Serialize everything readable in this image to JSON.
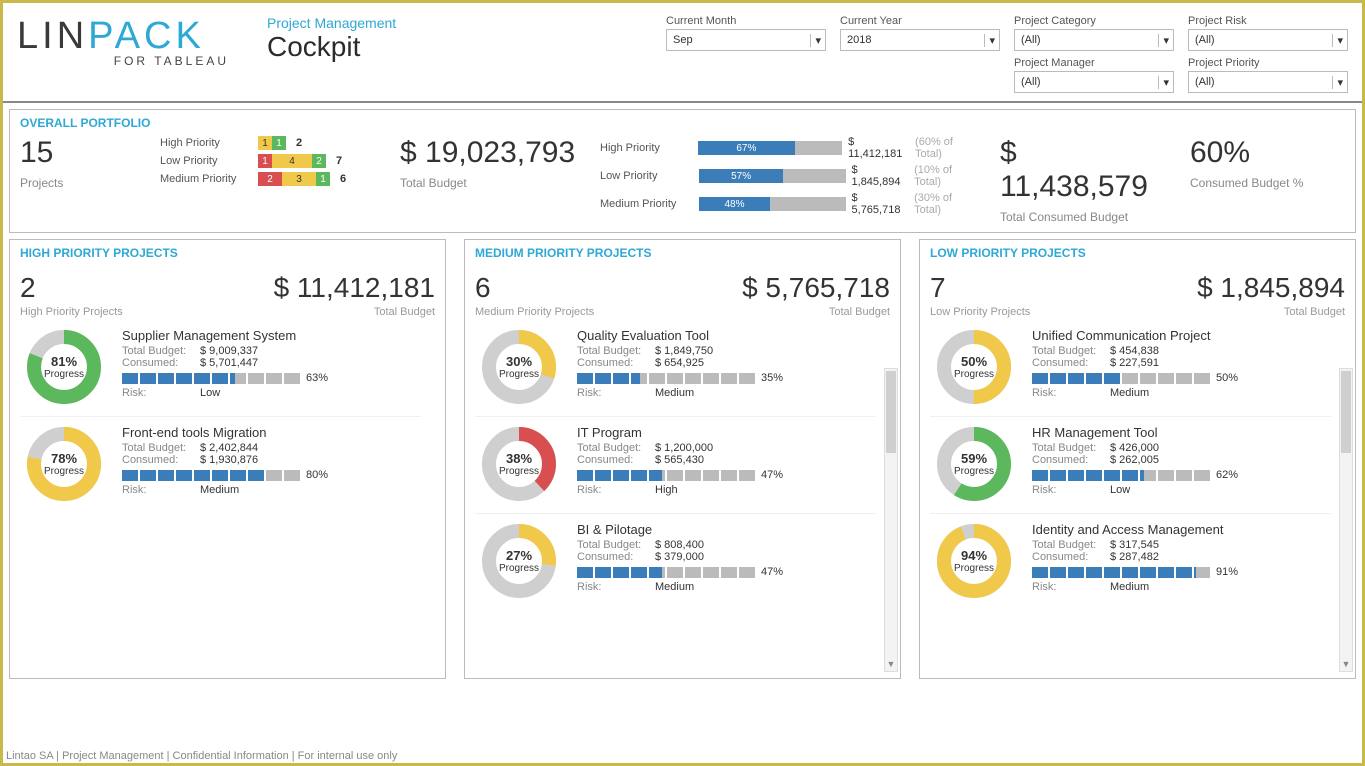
{
  "logo": {
    "part1": "LIN",
    "part2": "PACK",
    "sub": "FOR TABLEAU"
  },
  "title": {
    "section": "Project Management",
    "main": "Cockpit"
  },
  "filters": {
    "items": [
      {
        "label": "Current Month",
        "value": "Sep"
      },
      {
        "label": "Current Year",
        "value": "2018"
      },
      {
        "label": "Project Category",
        "value": "(All)"
      },
      {
        "label": "Project Risk",
        "value": "(All)"
      },
      {
        "label": "",
        "value": ""
      },
      {
        "label": "",
        "value": ""
      },
      {
        "label": "Project Manager",
        "value": "(All)"
      },
      {
        "label": "Project Priority",
        "value": "(All)"
      }
    ]
  },
  "overall": {
    "title": "OVERALL PORTFOLIO",
    "projects": {
      "value": "15",
      "label": "Projects"
    },
    "priority_counts": [
      {
        "name": "High Priority",
        "segments": [
          {
            "w": 14,
            "c": "c-yellow",
            "t": "1"
          },
          {
            "w": 14,
            "c": "c-green",
            "t": "1"
          }
        ],
        "count": "2"
      },
      {
        "name": "Low Priority",
        "segments": [
          {
            "w": 14,
            "c": "c-red",
            "t": "1"
          },
          {
            "w": 40,
            "c": "c-yellow",
            "t": "4"
          },
          {
            "w": 14,
            "c": "c-green",
            "t": "2"
          }
        ],
        "count": "7"
      },
      {
        "name": "Medium Priority",
        "segments": [
          {
            "w": 24,
            "c": "c-red",
            "t": "2"
          },
          {
            "w": 34,
            "c": "c-yellow",
            "t": "3"
          },
          {
            "w": 14,
            "c": "c-green",
            "t": "1"
          }
        ],
        "count": "6"
      }
    ],
    "total_budget": {
      "value": "$ 19,023,793",
      "label": "Total Budget"
    },
    "consumed_bars": [
      {
        "name": "High Priority",
        "pct": 67,
        "amount": "$ 11,412,181",
        "share": "(60% of Total)"
      },
      {
        "name": "Low Priority",
        "pct": 57,
        "amount": "$ 1,845,894",
        "share": "(10% of Total)"
      },
      {
        "name": "Medium Priority",
        "pct": 48,
        "amount": "$ 5,765,718",
        "share": "(30% of Total)"
      }
    ],
    "total_consumed": {
      "value": "$ 11,438,579",
      "label": "Total Consumed Budget"
    },
    "consumed_pct": {
      "value": "60%",
      "label": "Consumed Budget %"
    }
  },
  "columns": [
    {
      "title": "HIGH PRIORITY PROJECTS",
      "count": "2",
      "count_label": "High Priority Projects",
      "budget": "$ 11,412,181",
      "budget_label": "Total Budget",
      "scroll": false,
      "projects": [
        {
          "name": "Supplier Management System",
          "progress": 81,
          "color": "#5cb85c",
          "total": "$ 9,009,337",
          "consumed": "$ 5,701,447",
          "bar": 63,
          "risk": "Low"
        },
        {
          "name": "Front-end tools Migration",
          "progress": 78,
          "color": "#f0c94a",
          "total": "$ 2,402,844",
          "consumed": "$ 1,930,876",
          "bar": 80,
          "risk": "Medium"
        }
      ]
    },
    {
      "title": "MEDIUM PRIORITY PROJECTS",
      "count": "6",
      "count_label": "Medium Priority Projects",
      "budget": "$ 5,765,718",
      "budget_label": "Total Budget",
      "scroll": true,
      "projects": [
        {
          "name": "Quality Evaluation Tool",
          "progress": 30,
          "color": "#f0c94a",
          "total": "$ 1,849,750",
          "consumed": "$ 654,925",
          "bar": 35,
          "risk": "Medium"
        },
        {
          "name": "IT Program",
          "progress": 38,
          "color": "#d94f4f",
          "total": "$ 1,200,000",
          "consumed": "$ 565,430",
          "bar": 47,
          "risk": "High"
        },
        {
          "name": "BI & Pilotage",
          "progress": 27,
          "color": "#f0c94a",
          "total": "$ 808,400",
          "consumed": "$ 379,000",
          "bar": 47,
          "risk": "Medium"
        }
      ]
    },
    {
      "title": "LOW PRIORITY PROJECTS",
      "count": "7",
      "count_label": "Low Priority Projects",
      "budget": "$ 1,845,894",
      "budget_label": "Total Budget",
      "scroll": true,
      "projects": [
        {
          "name": "Unified Communication Project",
          "progress": 50,
          "color": "#f0c94a",
          "total": "$ 454,838",
          "consumed": "$ 227,591",
          "bar": 50,
          "risk": "Medium"
        },
        {
          "name": "HR Management Tool",
          "progress": 59,
          "color": "#5cb85c",
          "total": "$ 426,000",
          "consumed": "$ 262,005",
          "bar": 62,
          "risk": "Low"
        },
        {
          "name": "Identity and Access Management",
          "progress": 94,
          "color": "#f0c94a",
          "total": "$ 317,545",
          "consumed": "$ 287,482",
          "bar": 91,
          "risk": "Medium"
        }
      ]
    }
  ],
  "labels": {
    "progress": "Progress",
    "total_budget": "Total Budget:",
    "consumed": "Consumed:",
    "risk": "Risk:"
  },
  "footer": "Lintao SA | Project Management  | Confidential Information | For internal use only",
  "chart_data": {
    "portfolio_counts": {
      "type": "bar",
      "title": "Project count by priority & risk (stacked)",
      "categories": [
        "High Priority",
        "Low Priority",
        "Medium Priority"
      ],
      "series": [
        {
          "name": "Red",
          "values": [
            0,
            1,
            2
          ]
        },
        {
          "name": "Yellow",
          "values": [
            1,
            4,
            3
          ]
        },
        {
          "name": "Green",
          "values": [
            1,
            2,
            1
          ]
        }
      ],
      "totals": [
        2,
        7,
        6
      ]
    },
    "consumed_by_priority": {
      "type": "bar",
      "title": "Consumed budget by priority",
      "categories": [
        "High Priority",
        "Low Priority",
        "Medium Priority"
      ],
      "values_pct": [
        67,
        57,
        48
      ],
      "values_usd": [
        11412181,
        1845894,
        5765718
      ],
      "share_of_total_pct": [
        60,
        10,
        30
      ]
    },
    "kpis": {
      "projects": 15,
      "total_budget_usd": 19023793,
      "total_consumed_usd": 11438579,
      "consumed_pct": 60
    },
    "project_progress": {
      "type": "table",
      "columns": [
        "priority",
        "project",
        "progress_pct",
        "total_budget_usd",
        "consumed_usd",
        "consumed_pct",
        "risk"
      ],
      "rows": [
        [
          "High",
          "Supplier Management System",
          81,
          9009337,
          5701447,
          63,
          "Low"
        ],
        [
          "High",
          "Front-end tools Migration",
          78,
          2402844,
          1930876,
          80,
          "Medium"
        ],
        [
          "Medium",
          "Quality Evaluation Tool",
          30,
          1849750,
          654925,
          35,
          "Medium"
        ],
        [
          "Medium",
          "IT Program",
          38,
          1200000,
          565430,
          47,
          "High"
        ],
        [
          "Medium",
          "BI & Pilotage",
          27,
          808400,
          379000,
          47,
          "Medium"
        ],
        [
          "Low",
          "Unified Communication Project",
          50,
          454838,
          227591,
          50,
          "Medium"
        ],
        [
          "Low",
          "HR Management Tool",
          59,
          426000,
          262005,
          62,
          "Low"
        ],
        [
          "Low",
          "Identity and Access Management",
          94,
          317545,
          287482,
          91,
          "Medium"
        ]
      ]
    }
  }
}
